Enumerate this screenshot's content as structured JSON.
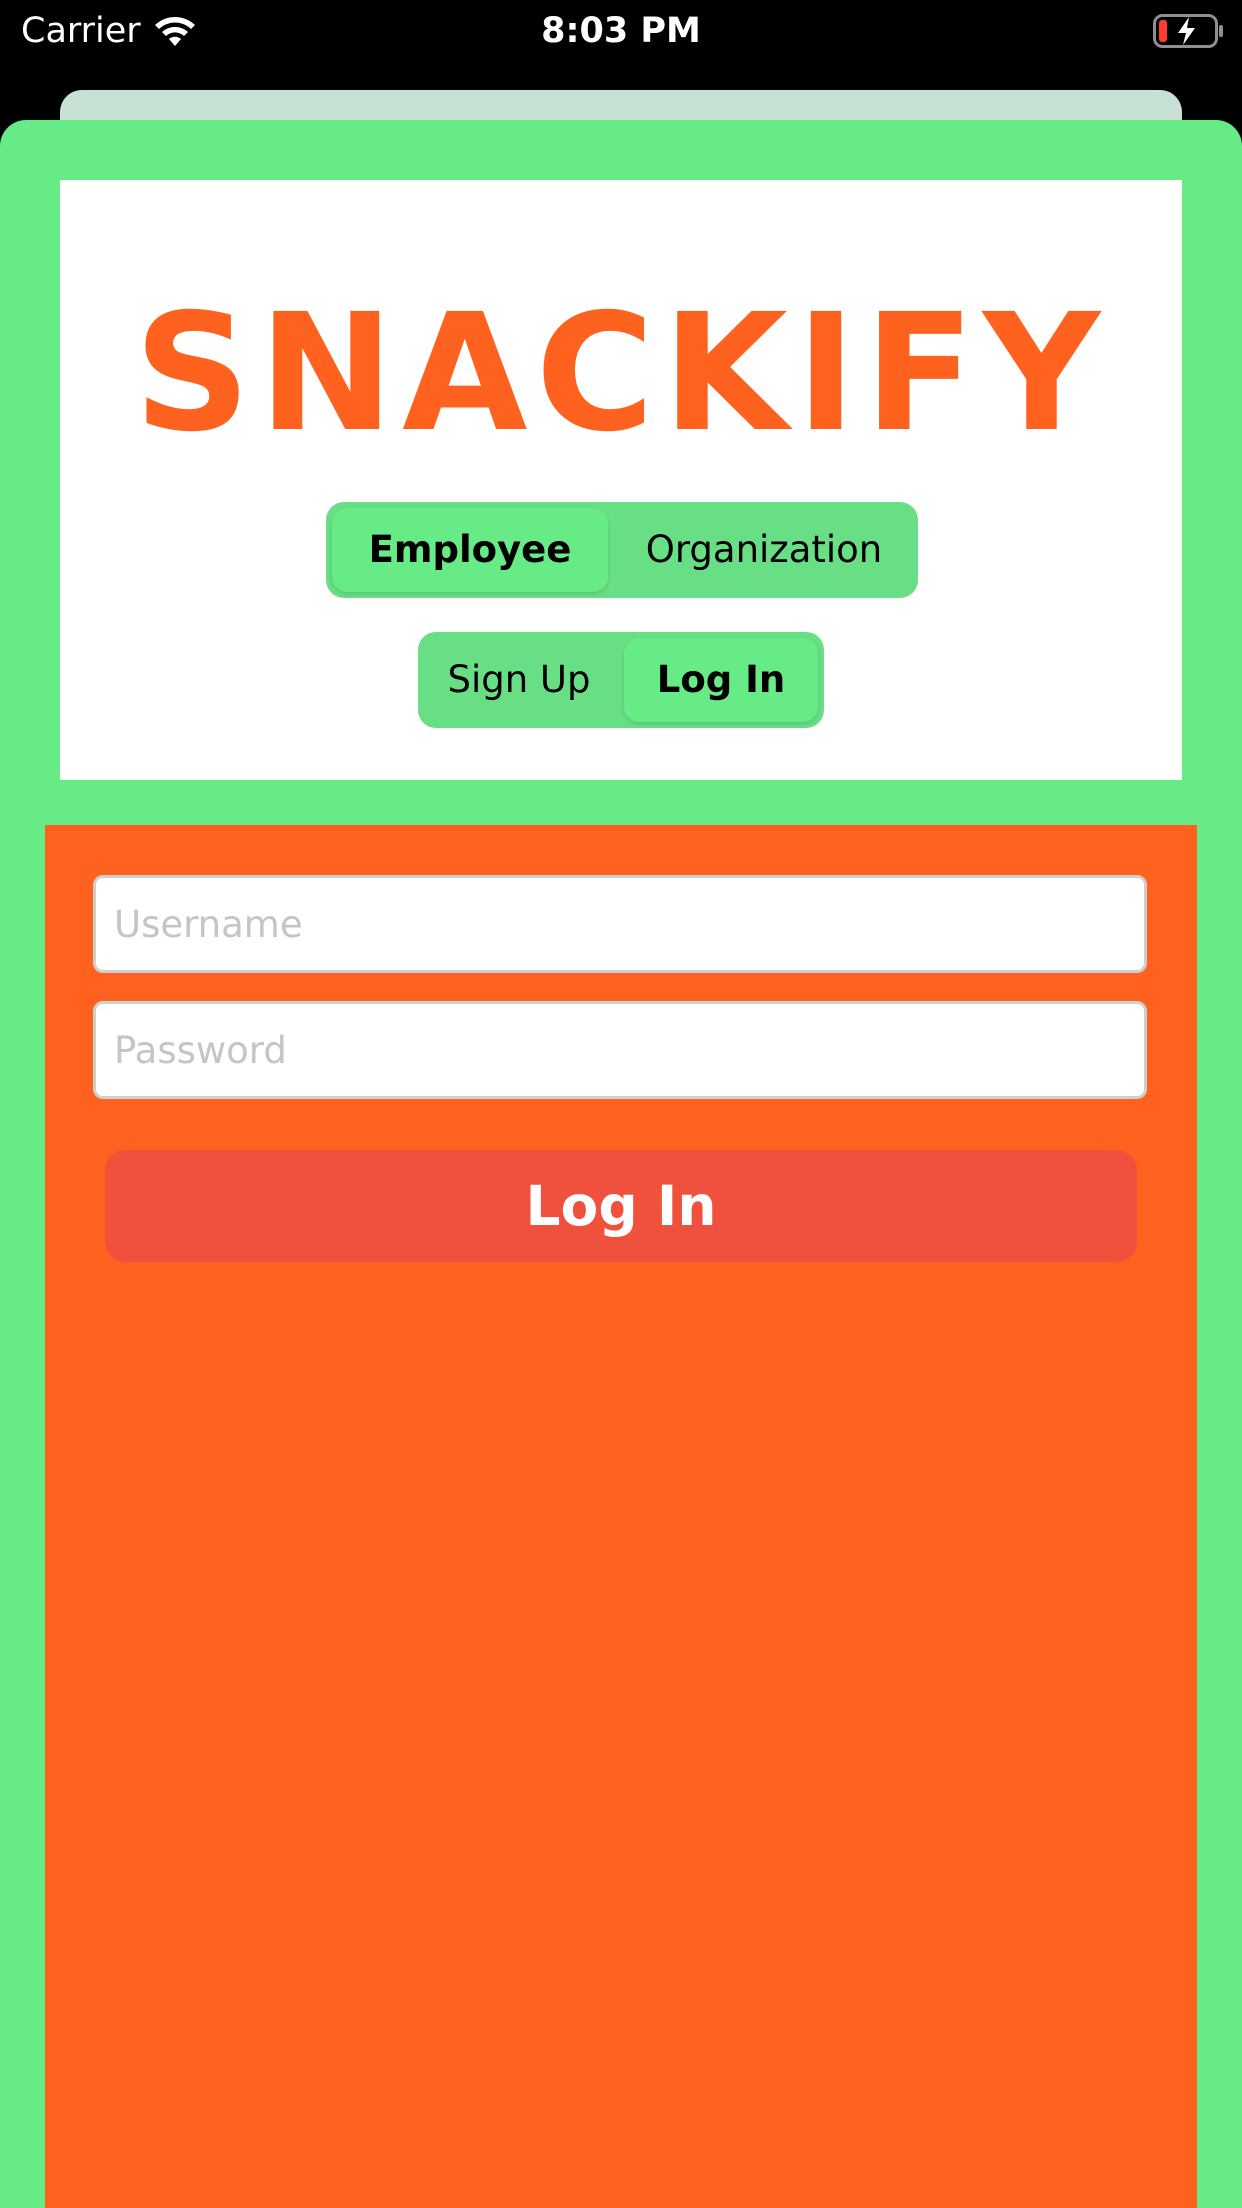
{
  "status_bar": {
    "carrier": "Carrier",
    "time": "8:03 PM",
    "icons": [
      "wifi-icon",
      "battery-charging-icon"
    ]
  },
  "header": {
    "logo_text": "SNACKIFY",
    "role_segment": {
      "options": [
        "Employee",
        "Organization"
      ],
      "selected": "Employee"
    },
    "mode_segment": {
      "options": [
        "Sign Up",
        "Log In"
      ],
      "selected": "Log In"
    }
  },
  "form": {
    "username_placeholder": "Username",
    "username_value": "",
    "password_placeholder": "Password",
    "password_value": "",
    "submit_label": "Log In"
  },
  "colors": {
    "brand_orange": "#ff621e",
    "green": "#66eb86",
    "segment_green": "#68de85",
    "button_red": "#f0513d"
  }
}
